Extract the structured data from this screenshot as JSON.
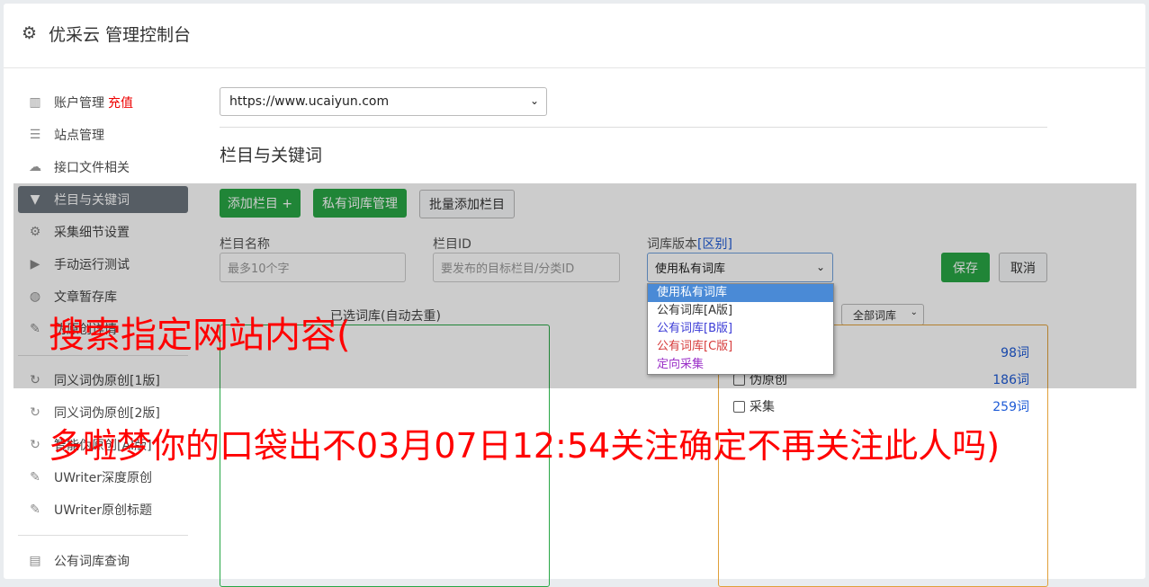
{
  "header": {
    "title": "优采云 管理控制台"
  },
  "sidebar": {
    "items": [
      {
        "label": "账户管理",
        "badge": "充值",
        "icon": "bar-chart-icon"
      },
      {
        "label": "站点管理",
        "icon": "server-icon"
      },
      {
        "label": "接口文件相关",
        "icon": "cloud-upload-icon"
      },
      {
        "label": "栏目与关键词",
        "icon": "filter-icon",
        "active": true
      },
      {
        "label": "采集细节设置",
        "icon": "cogs-icon"
      },
      {
        "label": "手动运行测试",
        "icon": "play-circle-icon"
      },
      {
        "label": "文章暂存库",
        "icon": "database-icon"
      },
      {
        "label": "伪原创详情",
        "icon": "edit-icon"
      },
      {
        "label": "同义词伪原创[1版]",
        "icon": "refresh-icon"
      },
      {
        "label": "同义词伪原创[2版]",
        "icon": "refresh-icon"
      },
      {
        "label": "智能伪原创[AI版]",
        "icon": "refresh-icon"
      },
      {
        "label": "UWriter深度原创",
        "icon": "edit-icon"
      },
      {
        "label": "UWriter原创标题",
        "icon": "edit-icon"
      },
      {
        "label": "公有词库查询",
        "icon": "book-icon"
      }
    ]
  },
  "site_select": {
    "value": "https://www.ucaiyun.com"
  },
  "section": {
    "title": "栏目与关键词"
  },
  "toolbar": {
    "add_column": "添加栏目 +",
    "private_lexicon": "私有词库管理",
    "batch_add": "批量添加栏目"
  },
  "form": {
    "column_name_label": "栏目名称",
    "column_name_placeholder": "最多10个字",
    "column_id_label": "栏目ID",
    "column_id_placeholder": "要发布的目标栏目/分类ID",
    "lexicon_version_label": "词库版本",
    "lexicon_version_link": "[区别]",
    "lexicon_version_value": "使用私有词库",
    "save": "保存",
    "cancel": "取消"
  },
  "dropdown": {
    "options": [
      {
        "label": "使用私有词库",
        "color": "#ffffff"
      },
      {
        "label": "公有词库[A版]",
        "color": "#333333"
      },
      {
        "label": "公有词库[B版]",
        "color": "#3b3bd6"
      },
      {
        "label": "公有词库[C版]",
        "color": "#d63b3b"
      },
      {
        "label": "定向采集",
        "color": "#9b30c8"
      }
    ]
  },
  "selected_box": {
    "title": "已选词库(自动去重)"
  },
  "filter_select": {
    "value": "全部词库"
  },
  "lexicon_rows": [
    {
      "label": "",
      "count": "98词"
    },
    {
      "label": "伪原创",
      "count": "186词"
    },
    {
      "label": "采集",
      "count": "259词"
    }
  ],
  "watermark": {
    "line1": "搜索指定网站内容(",
    "line2": "多啦梦你的口袋出不03月07日12:54关注确定不再关注此人吗)"
  }
}
